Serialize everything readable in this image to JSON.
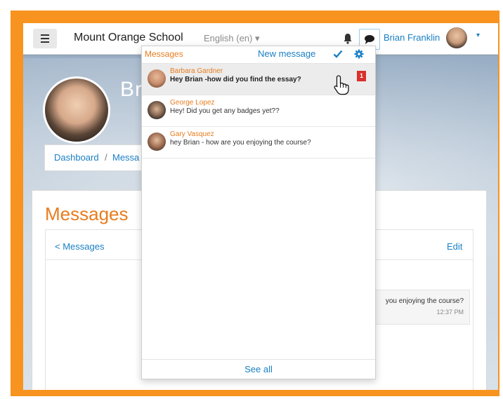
{
  "navbar": {
    "site_name": "Mount Orange School",
    "language": "English (en) ▾",
    "user_name": "Brian Franklin",
    "user_caret": "▾"
  },
  "profile": {
    "name_partial": "Br"
  },
  "breadcrumb": {
    "dashboard": "Dashboard",
    "separator": "/",
    "messages_partial": "Messa"
  },
  "main": {
    "title": "Messages",
    "back_link": "< Messages",
    "edit_link": "Edit",
    "conversation_snippet": "you enjoying the course?",
    "conversation_time": "12:37 PM"
  },
  "popover": {
    "title": "Messages",
    "new_message": "New message",
    "see_all": "See all",
    "items": [
      {
        "sender": "Barbara Gardner",
        "text": "Hey Brian -how did you find the essay?",
        "unread_count": "1",
        "avatar_color": "#c88f6e"
      },
      {
        "sender": "George Lopez",
        "text": "Hey! Did you get any badges yet??",
        "avatar_color": "#3b3430"
      },
      {
        "sender": "Gary Vasquez",
        "text": "hey Brian - how are you enjoying the course?",
        "avatar_color": "#8a5a3c"
      }
    ]
  },
  "colors": {
    "frame": "#f7931e",
    "accent_orange": "#e87d1e",
    "link_blue": "#1a7fc4",
    "badge_red": "#d9302b"
  },
  "icons": {
    "menu": "hamburger-icon",
    "bell": "bell-icon",
    "messages": "speech-bubble-icon",
    "mark_read": "check-icon",
    "settings": "gear-icon",
    "cursor": "hand-pointer-icon"
  }
}
